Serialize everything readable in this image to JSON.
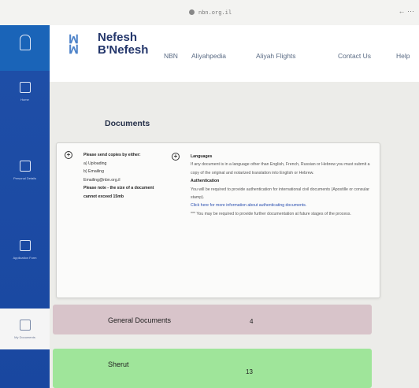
{
  "browser": {
    "url": "nbn.org.il"
  },
  "sidebar": {
    "top_label": "",
    "items": [
      {
        "label": "Home",
        "active": false
      },
      {
        "label": "Personal Details",
        "active": false
      },
      {
        "label": "Application Form",
        "active": false
      },
      {
        "label": "My Documents",
        "active": true
      }
    ]
  },
  "header": {
    "logo_line1": "Nefesh",
    "logo_line2": "B'Nefesh",
    "menu": [
      "NBN",
      "Aliyahpedia",
      "Aliyah Flights",
      "Contact Us",
      "Help"
    ]
  },
  "page": {
    "title": "Documents",
    "info_left": {
      "heading": "Please send copies by either:",
      "lines": [
        "a) Uploading",
        "b) Emailing",
        "Emailing@nbn.org.il"
      ],
      "note": "Please note - the size of a document cannot exceed 15mb"
    },
    "info_right": {
      "languages_heading": "Languages",
      "languages_text": "If any document is in a language other than English, French, Russian or Hebrew you must submit a copy of the original and notarized translation into English or Hebrew.",
      "auth_heading": "Authentication",
      "auth_text": "You will be required to provide authentication for international civil documents (Apostille or consular stamp).",
      "auth_link": "Click here for more information about authenticating documents.",
      "note": "*** You may be required to provide further documentation at future stages of the process."
    },
    "sections": [
      {
        "name": "General Documents",
        "count": "4",
        "color": "#d8c4ca"
      },
      {
        "name": "Sherut",
        "count": "13",
        "color": "#9fe59a"
      }
    ]
  }
}
